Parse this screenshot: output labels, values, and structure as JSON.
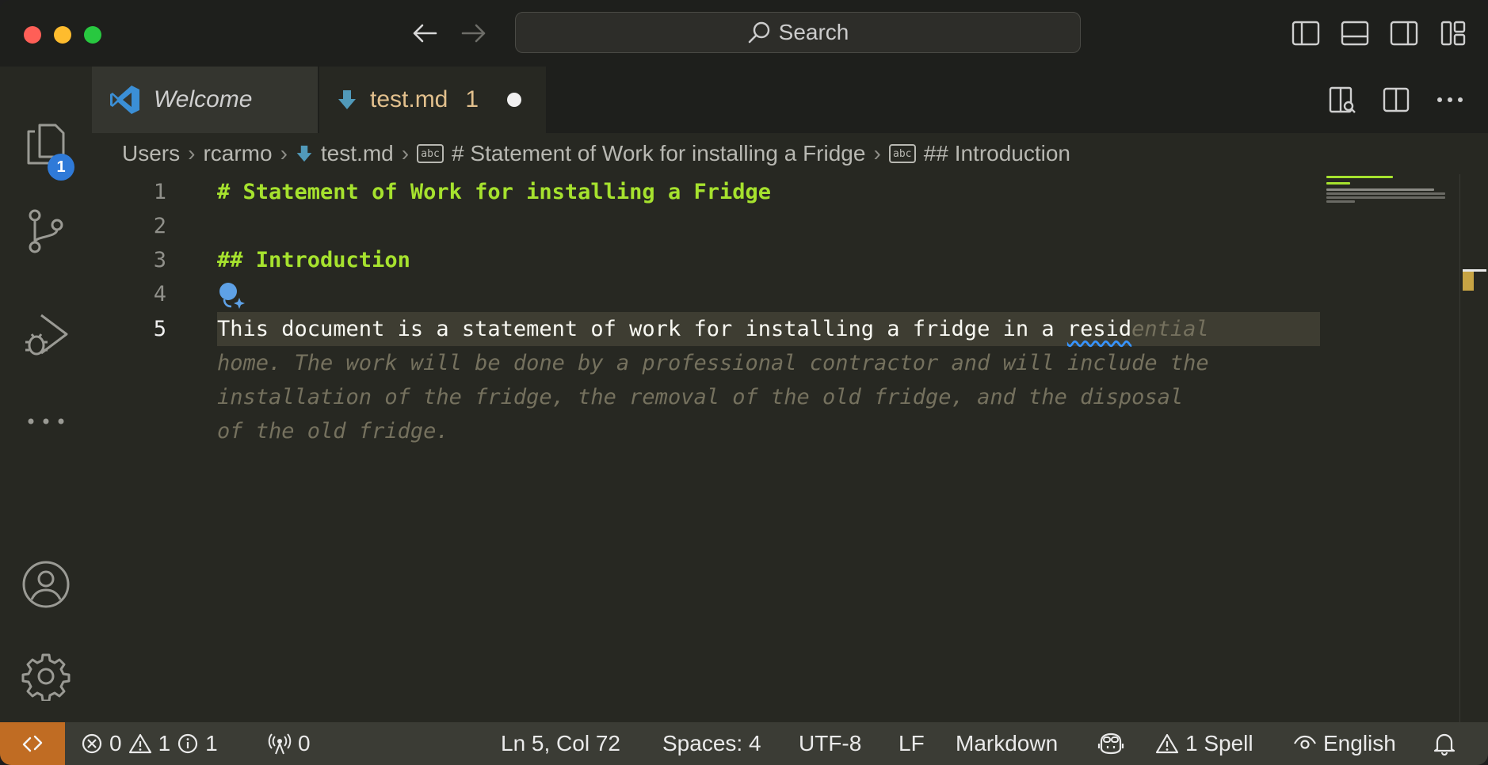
{
  "titlebar": {
    "search_label": "Search"
  },
  "activity": {
    "explorer_badge": "1"
  },
  "tabs": [
    {
      "label": "Welcome"
    },
    {
      "label": "test.md",
      "problems": "1"
    }
  ],
  "breadcrumb": {
    "users": "Users",
    "rcarmo": "rcarmo",
    "file": "test.md",
    "h1": "# Statement of Work for installing a Fridge",
    "h2": "## Introduction"
  },
  "editor": {
    "line_numbers": [
      "1",
      "2",
      "3",
      "4",
      "5"
    ],
    "line1": "# Statement of Work for installing a Fridge",
    "line3": "## Introduction",
    "line5_typed_a": "This document is a statement of work for installing a fridge in a ",
    "line5_typed_b": "resid",
    "ghost_1": "ential",
    "ghost_2": "home. The work will be done by a professional contractor and will include the",
    "ghost_3": "installation of the fridge, the removal of the old fridge, and the disposal",
    "ghost_4": "of the old fridge."
  },
  "statusbar": {
    "errors": "0",
    "warnings": "1",
    "infos": "1",
    "ports": "0",
    "position": "Ln 5, Col 72",
    "spaces": "Spaces: 4",
    "encoding": "UTF-8",
    "eol": "LF",
    "language": "Markdown",
    "spell": "1 Spell",
    "locale": "English"
  },
  "colors": {
    "heading": "#a6e22e",
    "ghost_text": "#75715e",
    "remote_bg": "#c06c23",
    "badge": "#2f7ad8",
    "modified_tab": "#e2c08d"
  }
}
